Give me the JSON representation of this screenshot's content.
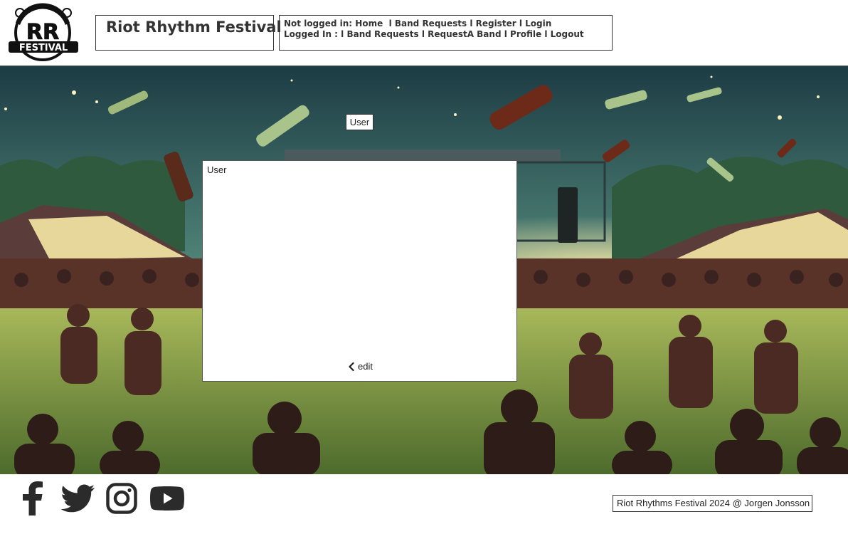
{
  "header": {
    "logo_text": "RR",
    "logo_subtext": "FESTIVAL",
    "site_title": "Riot Rhythm Festival",
    "nav": {
      "logged_out_prefix": "Not logged in:",
      "logged_out_items": [
        "Home",
        "l Band Requests",
        "l Register",
        "l Login"
      ],
      "logged_in_prefix": "Logged In :",
      "logged_in_items": [
        "l Band Requests",
        "l RequestA Band",
        "l Profile",
        "l Logout"
      ]
    }
  },
  "hero": {
    "user_tag": "User",
    "panel": {
      "title": "User",
      "edit_label": "edit"
    }
  },
  "footer": {
    "social_icons": [
      "facebook-icon",
      "twitter-icon",
      "instagram-icon",
      "youtube-icon"
    ],
    "copyright": "Riot Rhythms Festival 2024 @ Jorgen Jonsson"
  },
  "colors": {
    "sky_top": "#1f3f44",
    "sky_bottom": "#7fb08f",
    "grass": "#8fa84a",
    "border": "#333333"
  }
}
